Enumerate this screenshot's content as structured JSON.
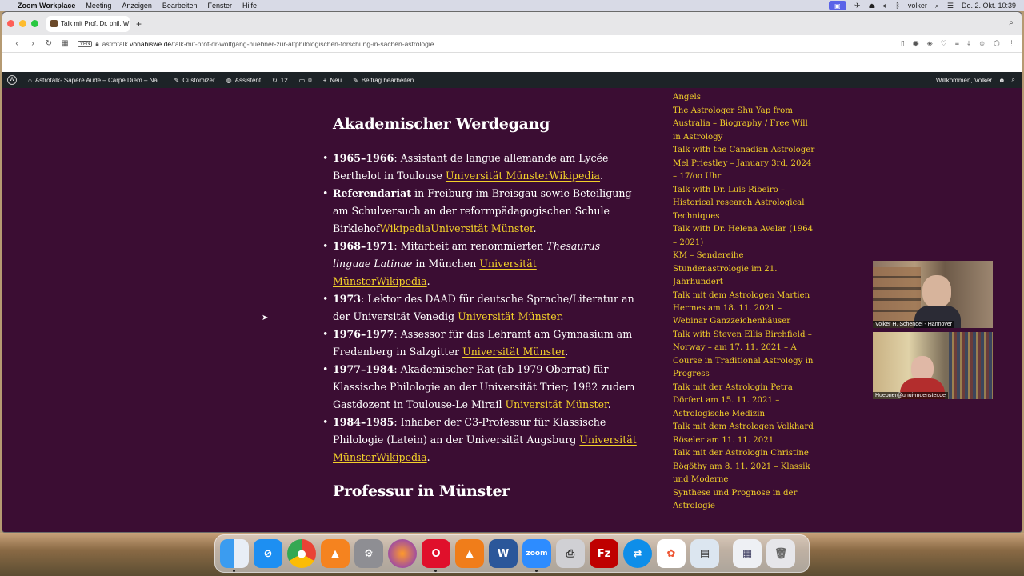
{
  "menubar": {
    "app_name": "Zoom Workplace",
    "items": [
      "Meeting",
      "Anzeigen",
      "Bearbeiten",
      "Fenster",
      "Hilfe"
    ],
    "user": "volker",
    "datetime": "Do. 2. Okt.  10:39"
  },
  "browser": {
    "tab_title": "Talk mit Prof. Dr. phil. W",
    "url_prefix": "astrotalk.",
    "url_host": "vonabiswe.de",
    "url_path": "/talk-mit-prof-dr-wolfgang-huebner-zur-altphilologischen-forschung-in-sachen-astrologie",
    "vpn_label": "VPN"
  },
  "wp_adminbar": {
    "site_name": "Astrotalk- Sapere Aude – Carpe Diem – Na...",
    "customizer": "Customizer",
    "assistant": "Assistent",
    "updates_count": "12",
    "comments_count": "0",
    "new_label": "Neu",
    "edit_label": "Beitrag bearbeiten",
    "welcome": "Willkommen, Volker"
  },
  "article": {
    "heading_1": "Akademischer Werdegang",
    "heading_2": "Professur in Münster",
    "items": [
      {
        "bold": "1965–1966",
        "text": ": Assistant de langue allemande am Lycée Berthelot in Toulouse ",
        "link": "Universität MünsterWikipedia",
        "after": "."
      },
      {
        "bold": "Referendariat",
        "text": " in Freiburg im Breisgau sowie Beteiligung am Schulversuch an der reformpädagogischen Schule Birklehof",
        "link": "WikipediaUniversität Münster",
        "after": "."
      },
      {
        "bold": "1968–1971",
        "text": ": Mitarbeit am renommierten ",
        "italic": "Thesaurus linguae Latinae",
        "text2": " in München ",
        "link": "Universität MünsterWikipedia",
        "after": "."
      },
      {
        "bold": "1973",
        "text": ": Lektor des DAAD für deutsche Sprache/Literatur an der Universität Venedig ",
        "link": "Universität Münster",
        "after": "."
      },
      {
        "bold": "1976–1977",
        "text": ": Assessor für das Lehramt am Gymnasium am Fredenberg in Salzgitter ",
        "link": "Universität Münster",
        "after": "."
      },
      {
        "bold": "1977–1984",
        "text": ": Akademischer Rat (ab 1979 Oberrat) für Klassische Philologie an der Universität Trier; 1982 zudem Gastdozent in Toulouse-Le Mirail ",
        "link": "Universität Münster",
        "after": "."
      },
      {
        "bold": "1984–1985",
        "text": ": Inhaber der C3-Professur für Klassische Philologie (Latein) an der Universität Augsburg ",
        "link": "Universität MünsterWikipedia",
        "after": "."
      }
    ]
  },
  "sidebar": {
    "posts": [
      "of Magic & Mastery – Planetary Angels",
      "The Astrologer Shu Yap from Australia – Biography / Free Will in Astrology",
      "Talk with the Canadian Astrologer Mel Priestley – January 3rd, 2024 – 17/oo Uhr",
      "Talk with Dr. Luis Ribeiro – Historical research Astrological Techniques",
      "Talk with Dr. Helena Avelar (1964 – 2021)",
      "KM – Sendereihe Stundenastrologie im 21. Jahrhundert",
      "Talk mit dem Astrologen Martien Hermes am 18. 11. 2021 – Webinar Ganzzeichenhäuser",
      "Talk with Steven Ellis Birchfield – Norway – am 17. 11. 2021 – A Course in Traditional Astrology in Progress",
      "Talk mit der Astrologin Petra Dörfert am 15. 11. 2021 – Astrologische Medizin",
      "Talk mit dem Astrologen Volkhard Röseler am 11. 11. 2021",
      "Talk mit der Astrologin Christine Bögöthy am 8. 11. 2021 – Klassik und Moderne",
      "Synthese und Prognose in der Astrologie"
    ]
  },
  "video": {
    "participant_1": "Volker H. Schendel - Hannover",
    "participant_2": "Huebner@unui-muenster.de"
  },
  "dock": {
    "apps": [
      "Finder",
      "Safari",
      "Chrome",
      "Artstudio",
      "System Settings",
      "Firefox",
      "Opera",
      "VLC",
      "Word",
      "Zoom",
      "Printer",
      "FileZilla",
      "TeamViewer",
      "Photos",
      "Preview",
      "Downloads",
      "Trash"
    ]
  }
}
